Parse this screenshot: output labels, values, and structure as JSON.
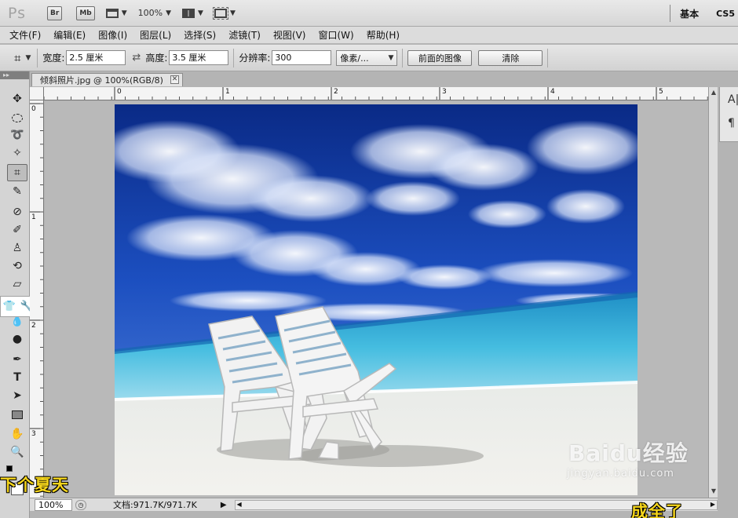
{
  "app": {
    "logo": "Ps",
    "bridge_button": "Br",
    "mini_bridge_button": "Mb",
    "zoom_level": "100%",
    "workspace": "基本",
    "cs5_label": "CS5"
  },
  "menu": {
    "items": [
      "文件(F)",
      "编辑(E)",
      "图像(I)",
      "图层(L)",
      "选择(S)",
      "滤镜(T)",
      "视图(V)",
      "窗口(W)",
      "帮助(H)"
    ]
  },
  "options": {
    "width_label": "宽度:",
    "width_value": "2.5 厘米",
    "height_label": "高度:",
    "height_value": "3.5 厘米",
    "resolution_label": "分辨率:",
    "resolution_value": "300",
    "resolution_unit": "像素/...",
    "front_image_button": "前面的图像",
    "clear_button": "清除"
  },
  "document": {
    "tab_title": "倾斜照片.jpg @ 100%(RGB/8)",
    "ruler_top_ticks": [
      "0",
      "1",
      "2",
      "3",
      "4",
      "5"
    ],
    "ruler_left_ticks": [
      "0",
      "1",
      "2",
      "3"
    ]
  },
  "status": {
    "zoom": "100%",
    "doc_info": "文档:971.7K/971.7K"
  },
  "panel": {
    "glyph_a": "A|",
    "glyph_b": "¶"
  },
  "overlay": {
    "caption_left": "下个夏天",
    "caption_right": "成全了",
    "watermark_main": "Baidu经验",
    "watermark_sub": "jingyan.baidu.com"
  },
  "icons": {
    "tools": [
      "move-icon",
      "marquee-icon",
      "lasso-icon",
      "quick-select-icon",
      "crop-icon",
      "eyedropper-icon",
      "healing-brush-icon",
      "brush-icon",
      "clone-stamp-icon",
      "history-brush-icon",
      "eraser-icon",
      "blur-icon",
      "dodge-icon",
      "pen-icon",
      "type-icon",
      "path-select-icon",
      "rectangle-icon",
      "hand-icon",
      "zoom-icon"
    ]
  },
  "colors": {
    "caption": "#f5d51b",
    "sky_top": "#0c2e8a",
    "sea": "#3fb2d6",
    "sand": "#eeeeea"
  }
}
